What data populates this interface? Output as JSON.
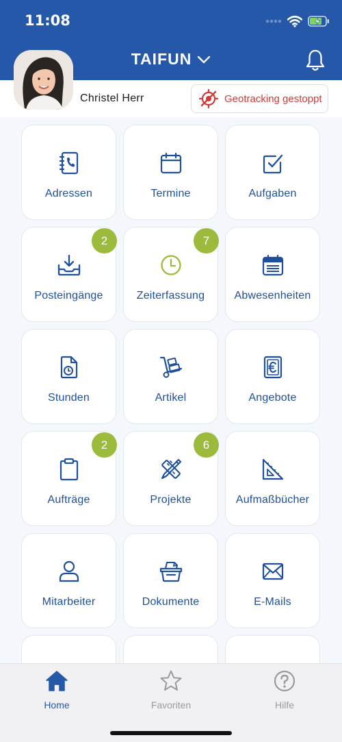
{
  "status_bar": {
    "time": "11:08"
  },
  "header": {
    "title": "TAIFUN"
  },
  "profile": {
    "name": "Christel Herr"
  },
  "geotracking": {
    "label": "Geotracking gestoppt"
  },
  "colors": {
    "header_bg": "#2558a8",
    "accent": "#1d4f9c",
    "badge": "#9cba3b",
    "geo_red": "#d23838",
    "clock_green": "#9cba3b"
  },
  "tiles": [
    {
      "label": "Adressen",
      "icon": "address-book-icon"
    },
    {
      "label": "Termine",
      "icon": "calendar-icon"
    },
    {
      "label": "Aufgaben",
      "icon": "checkbox-icon"
    },
    {
      "label": "Posteingänge",
      "icon": "inbox-download-icon",
      "badge": "2"
    },
    {
      "label": "Zeiterfassung",
      "icon": "clock-icon",
      "badge": "7"
    },
    {
      "label": "Abwesenheiten",
      "icon": "calendar-list-icon"
    },
    {
      "label": "Stunden",
      "icon": "document-clock-icon"
    },
    {
      "label": "Artikel",
      "icon": "hand-truck-icon"
    },
    {
      "label": "Angebote",
      "icon": "euro-document-icon"
    },
    {
      "label": "Aufträge",
      "icon": "clipboard-icon",
      "badge": "2"
    },
    {
      "label": "Projekte",
      "icon": "pencil-ruler-icon",
      "badge": "6"
    },
    {
      "label": "Aufmaßbücher",
      "icon": "set-square-icon"
    },
    {
      "label": "Mitarbeiter",
      "icon": "person-icon"
    },
    {
      "label": "Dokumente",
      "icon": "document-basket-icon"
    },
    {
      "label": "E-Mails",
      "icon": "envelope-icon"
    }
  ],
  "tabbar": {
    "items": [
      {
        "label": "Home",
        "icon": "home-icon",
        "active": true
      },
      {
        "label": "Favoriten",
        "icon": "star-icon",
        "active": false
      },
      {
        "label": "Hilfe",
        "icon": "help-icon",
        "active": false
      }
    ]
  }
}
